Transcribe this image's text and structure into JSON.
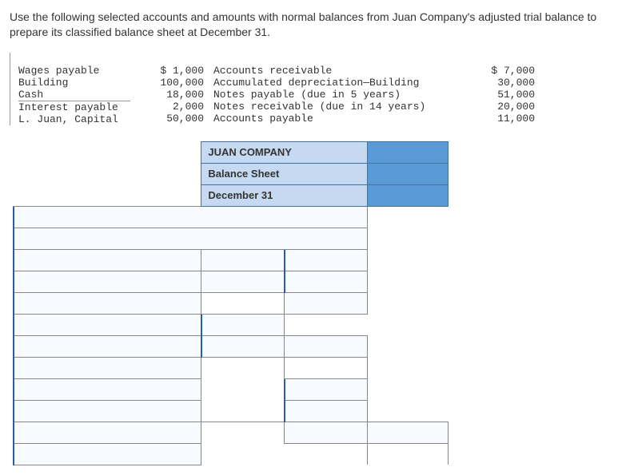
{
  "instructions": "Use the following selected accounts and amounts with normal balances from Juan Company's adjusted trial balance to prepare its classified balance sheet at December 31.",
  "trial_balance": {
    "left": [
      {
        "label": "Wages payable",
        "amount": "$ 1,000"
      },
      {
        "label": "Building",
        "amount": "100,000"
      },
      {
        "label": "Cash",
        "amount": "18,000"
      },
      {
        "label": "Interest payable",
        "amount": "2,000"
      },
      {
        "label": "L. Juan, Capital",
        "amount": "50,000"
      }
    ],
    "right": [
      {
        "label": "Accounts receivable",
        "amount": "$ 7,000"
      },
      {
        "label": "Accumulated depreciation—Building",
        "amount": "30,000"
      },
      {
        "label": "Notes payable (due in 5 years)",
        "amount": "51,000"
      },
      {
        "label": "Notes receivable (due in 14 years)",
        "amount": "20,000"
      },
      {
        "label": "Accounts payable",
        "amount": "11,000"
      }
    ]
  },
  "worksheet_header": {
    "company": "JUAN COMPANY",
    "title": "Balance Sheet",
    "date": "December 31"
  }
}
